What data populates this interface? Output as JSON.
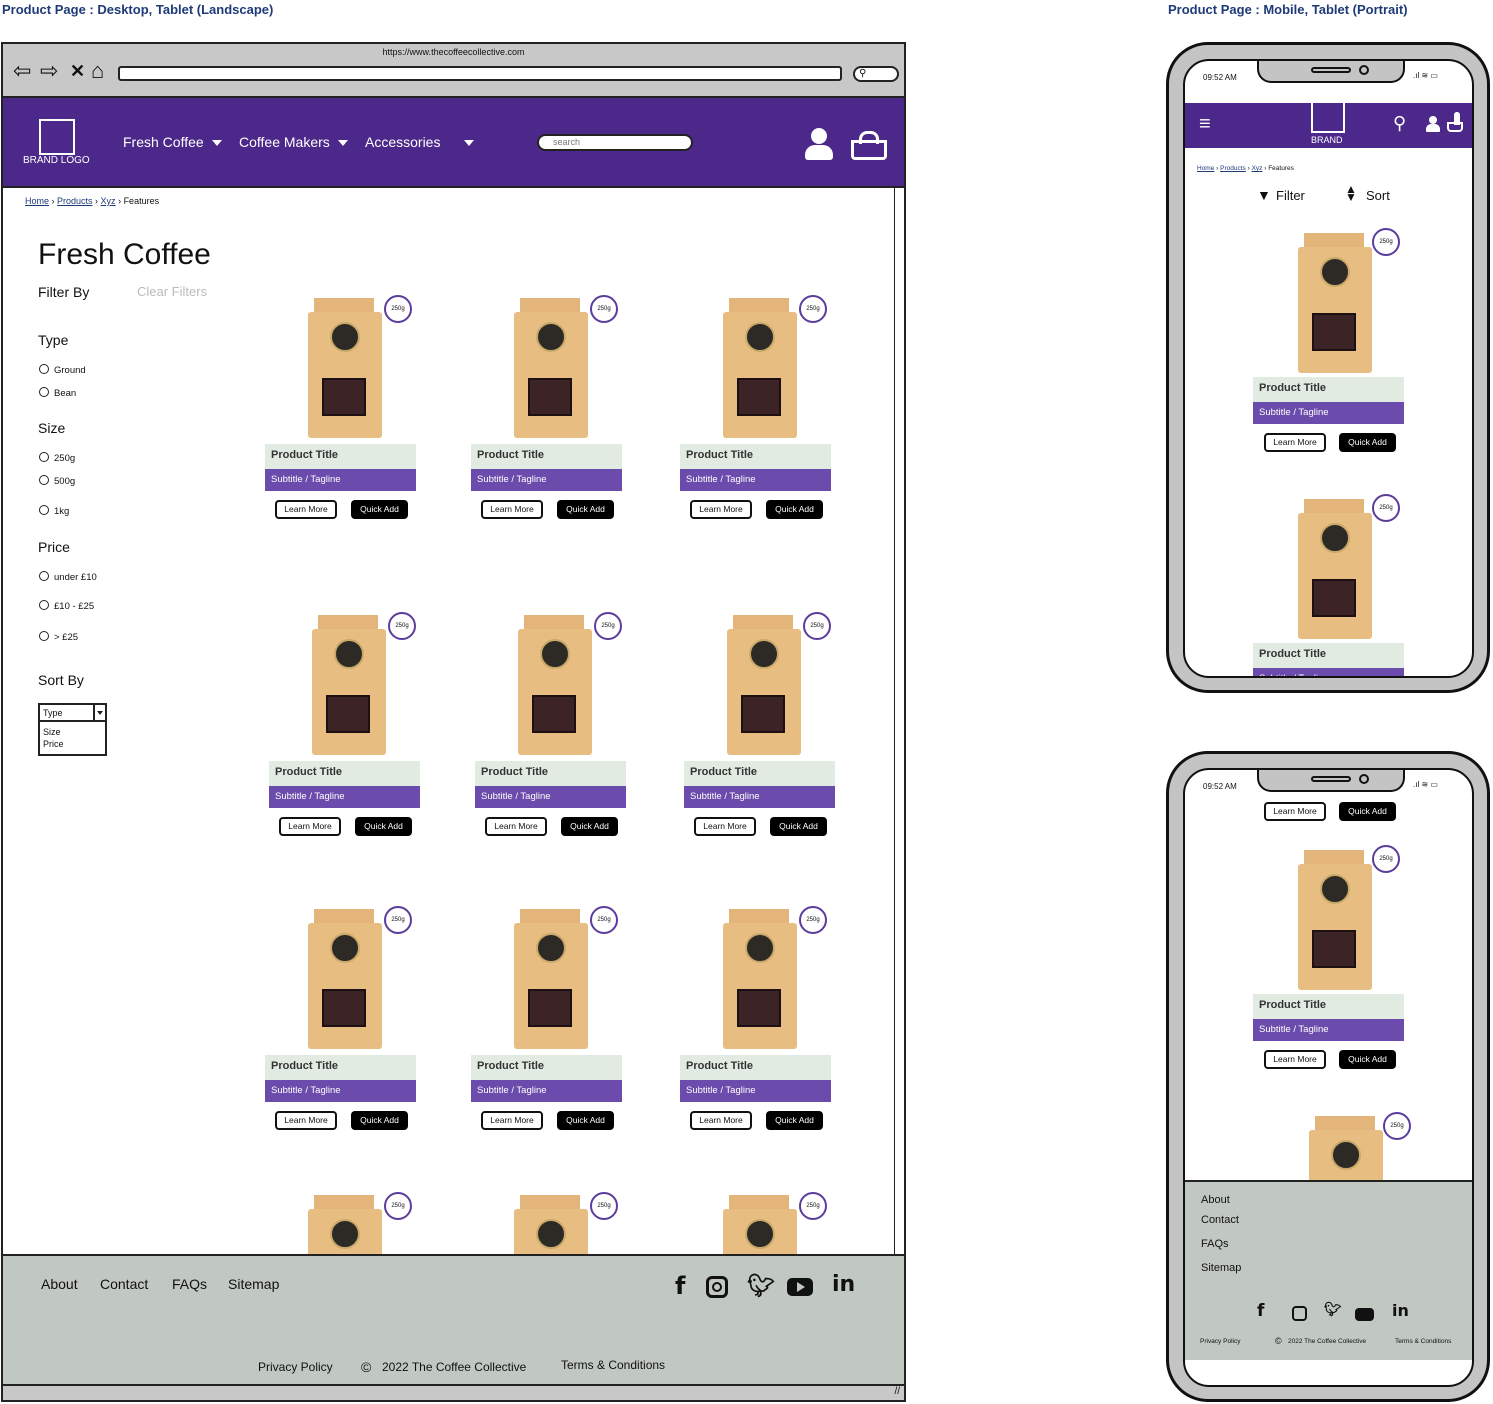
{
  "headings": {
    "desktop": "Product Page : Desktop, Tablet (Landscape)",
    "mobile": "Product Page : Mobile, Tablet (Portrait)"
  },
  "browser": {
    "url": "https://www.thecoffeecollective.com",
    "icons": [
      "back-arrow-icon",
      "forward-arrow-icon",
      "close-icon",
      "home-icon",
      "search-icon"
    ]
  },
  "nav": {
    "logo": "BRAND LOGO",
    "items": [
      "Fresh Coffee",
      "Coffee Makers",
      "Accessories"
    ],
    "search_placeholder": "search",
    "accent": "#4b2889"
  },
  "breadcrumb": {
    "home": "Home",
    "products": "Products",
    "xyz": "Xyz",
    "current": "Features"
  },
  "page_title": "Fresh Coffee",
  "filters": {
    "filter_by": "Filter By",
    "clear": "Clear Filters",
    "type": {
      "label": "Type",
      "options": [
        "Ground",
        "Bean"
      ]
    },
    "size": {
      "label": "Size",
      "options": [
        "250g",
        "500g",
        "1kg"
      ]
    },
    "price": {
      "label": "Price",
      "options": [
        "under £10",
        "£10 - £25",
        "> £25"
      ]
    },
    "sort_by": {
      "label": "Sort By",
      "selected": "Type",
      "options": [
        "Size",
        "Price"
      ]
    }
  },
  "product": {
    "badge": "250g",
    "title": "Product Title",
    "subtitle": "Subtitle / Tagline",
    "learn_more": "Learn More",
    "quick_add": "Quick Add"
  },
  "footer": {
    "links": [
      "About",
      "Contact",
      "FAQs",
      "Sitemap"
    ],
    "privacy": "Privacy Policy",
    "copyright": "2022 The Coffee Collective",
    "terms": "Terms & Conditions",
    "social_icons": [
      "facebook-icon",
      "instagram-icon",
      "twitter-icon",
      "youtube-icon",
      "linkedin-icon"
    ],
    "bg": "#c1c8c1"
  },
  "mobile": {
    "time": "09:52 AM",
    "brand": "BRAND",
    "filter": "Filter",
    "sort": "Sort"
  }
}
